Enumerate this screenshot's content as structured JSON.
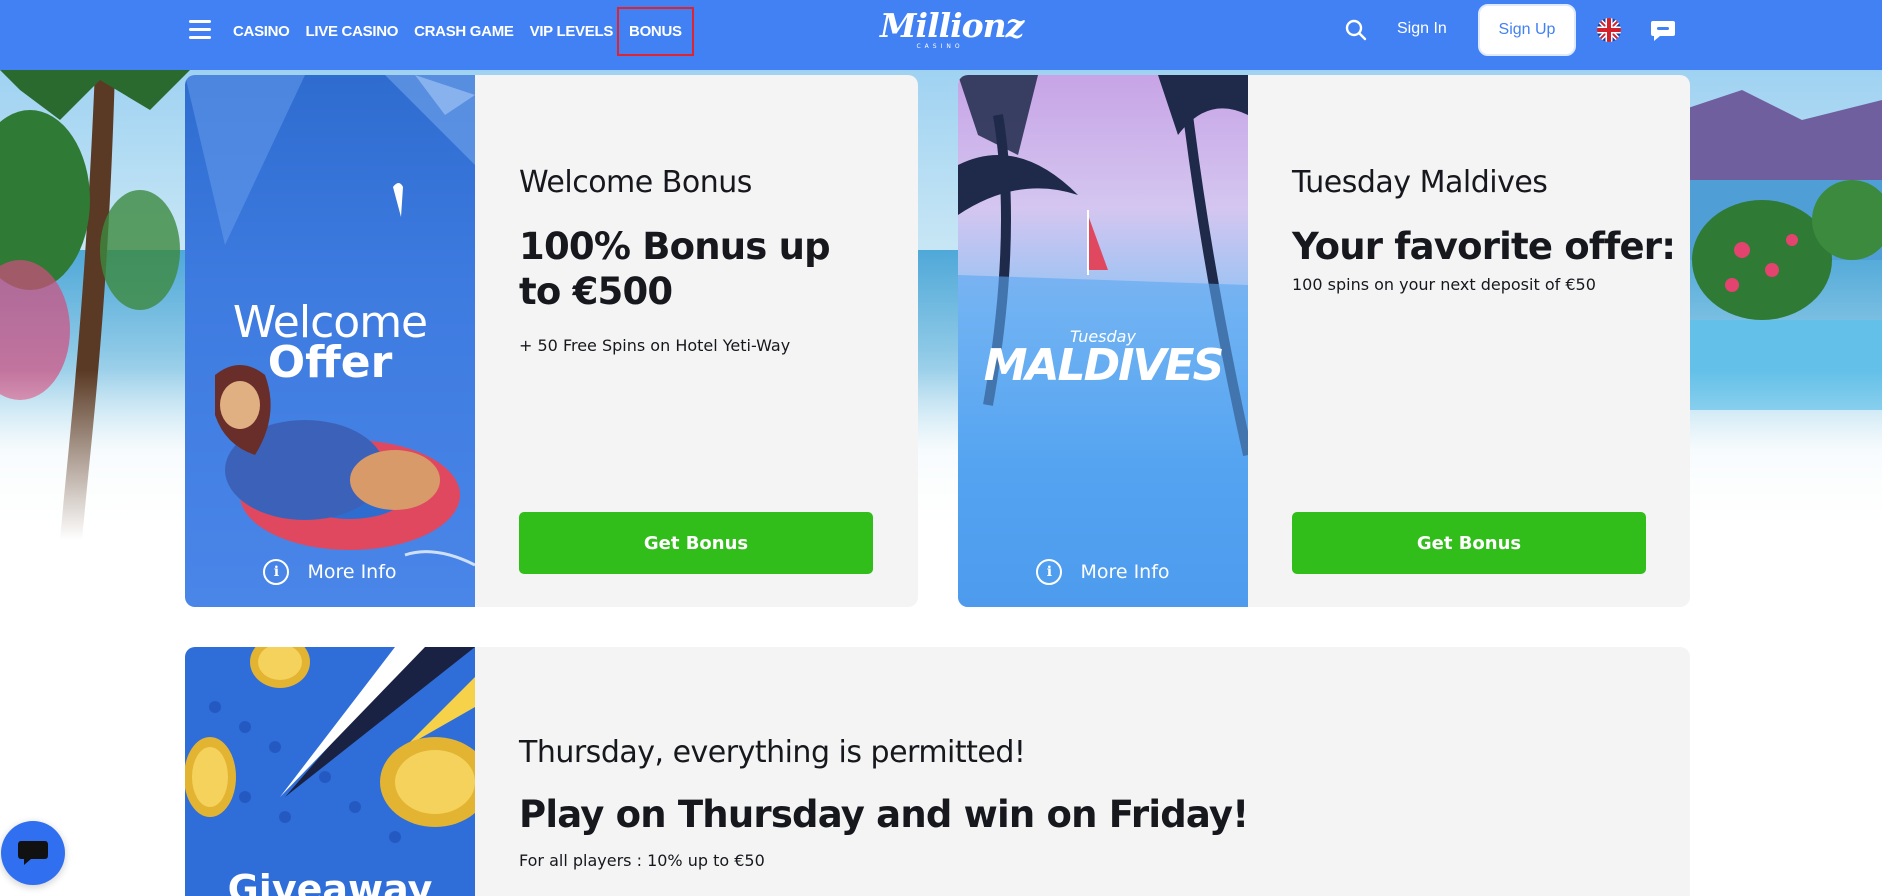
{
  "header": {
    "nav": [
      "CASINO",
      "LIVE CASINO",
      "CRASH GAME",
      "VIP LEVELS",
      "BONUS"
    ],
    "logo": "Millionz",
    "logo_sub": "CASINO",
    "signin": "Sign In",
    "signup": "Sign Up",
    "colors": {
      "bar": "#4281f4",
      "active_outline": "#e0242f"
    },
    "icons": [
      "menu-icon",
      "search-icon",
      "uk-flag-icon",
      "chat-icon"
    ]
  },
  "cards": [
    {
      "art_line1": "Welcome",
      "art_line2": "Offer",
      "title": "Welcome Bonus",
      "headline": "100% Bonus up to €500",
      "description": "+ 50 Free Spins on Hotel Yeti-Way",
      "button": "Get Bonus",
      "more_info": "More Info"
    },
    {
      "art_line1": "Tuesday",
      "art_line2": "MALDIVES",
      "title": "Tuesday Maldives",
      "headline": "Your favorite offer:",
      "description": "100 spins on your next deposit of €50",
      "button": "Get Bonus",
      "more_info": "More Info"
    },
    {
      "art_line1": "Giveaway",
      "title": "Thursday, everything is permitted!",
      "headline": "Play on Thursday and win on Friday!",
      "description": "For all players : 10% up to €50"
    }
  ],
  "colors": {
    "button_green": "#32be1a",
    "card_bg": "#f4f4f4"
  }
}
